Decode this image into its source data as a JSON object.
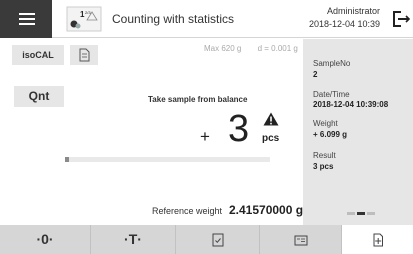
{
  "header": {
    "app_title": "Counting with statistics",
    "user": "Administrator",
    "datetime": "2018-12-04  10:39",
    "app_icon_superscript": "1",
    "app_icon_superscript2": "2/3"
  },
  "actions": {
    "isocal_label": "isoCAL",
    "qnt_label": "Qnt"
  },
  "balance": {
    "capacity": "Max 620 g",
    "readability": "d = 0.001 g",
    "instruction": "Take sample from balance",
    "sign": "+",
    "value": "3",
    "unit": "pcs",
    "progress_fraction": 0.02,
    "reference_label": "Reference weight",
    "reference_value": "2.41570000 g"
  },
  "info_panel": {
    "sample_label": "SampleNo",
    "sample_value": "2",
    "datetime_label": "Date/Time",
    "datetime_value": "2018-12-04 10:39:08",
    "weight_label": "Weight",
    "weight_value": "+ 6.099 g",
    "result_label": "Result",
    "result_value": "3 pcs"
  },
  "toolbar": {
    "zero_label": "·0·",
    "tare_label": "·T·"
  },
  "icons": {
    "menu": "menu-icon",
    "app": "counting-app-icon",
    "logout": "logout-icon",
    "doc": "document-icon",
    "warning": "warning-icon",
    "check_doc": "check-document-icon",
    "id_card": "id-card-icon",
    "add_doc": "add-document-icon"
  },
  "colors": {
    "header_dark": "#3a3a3a",
    "panel_bg": "#e6e6e6",
    "toolbar_bg": "#d6d6d6"
  }
}
